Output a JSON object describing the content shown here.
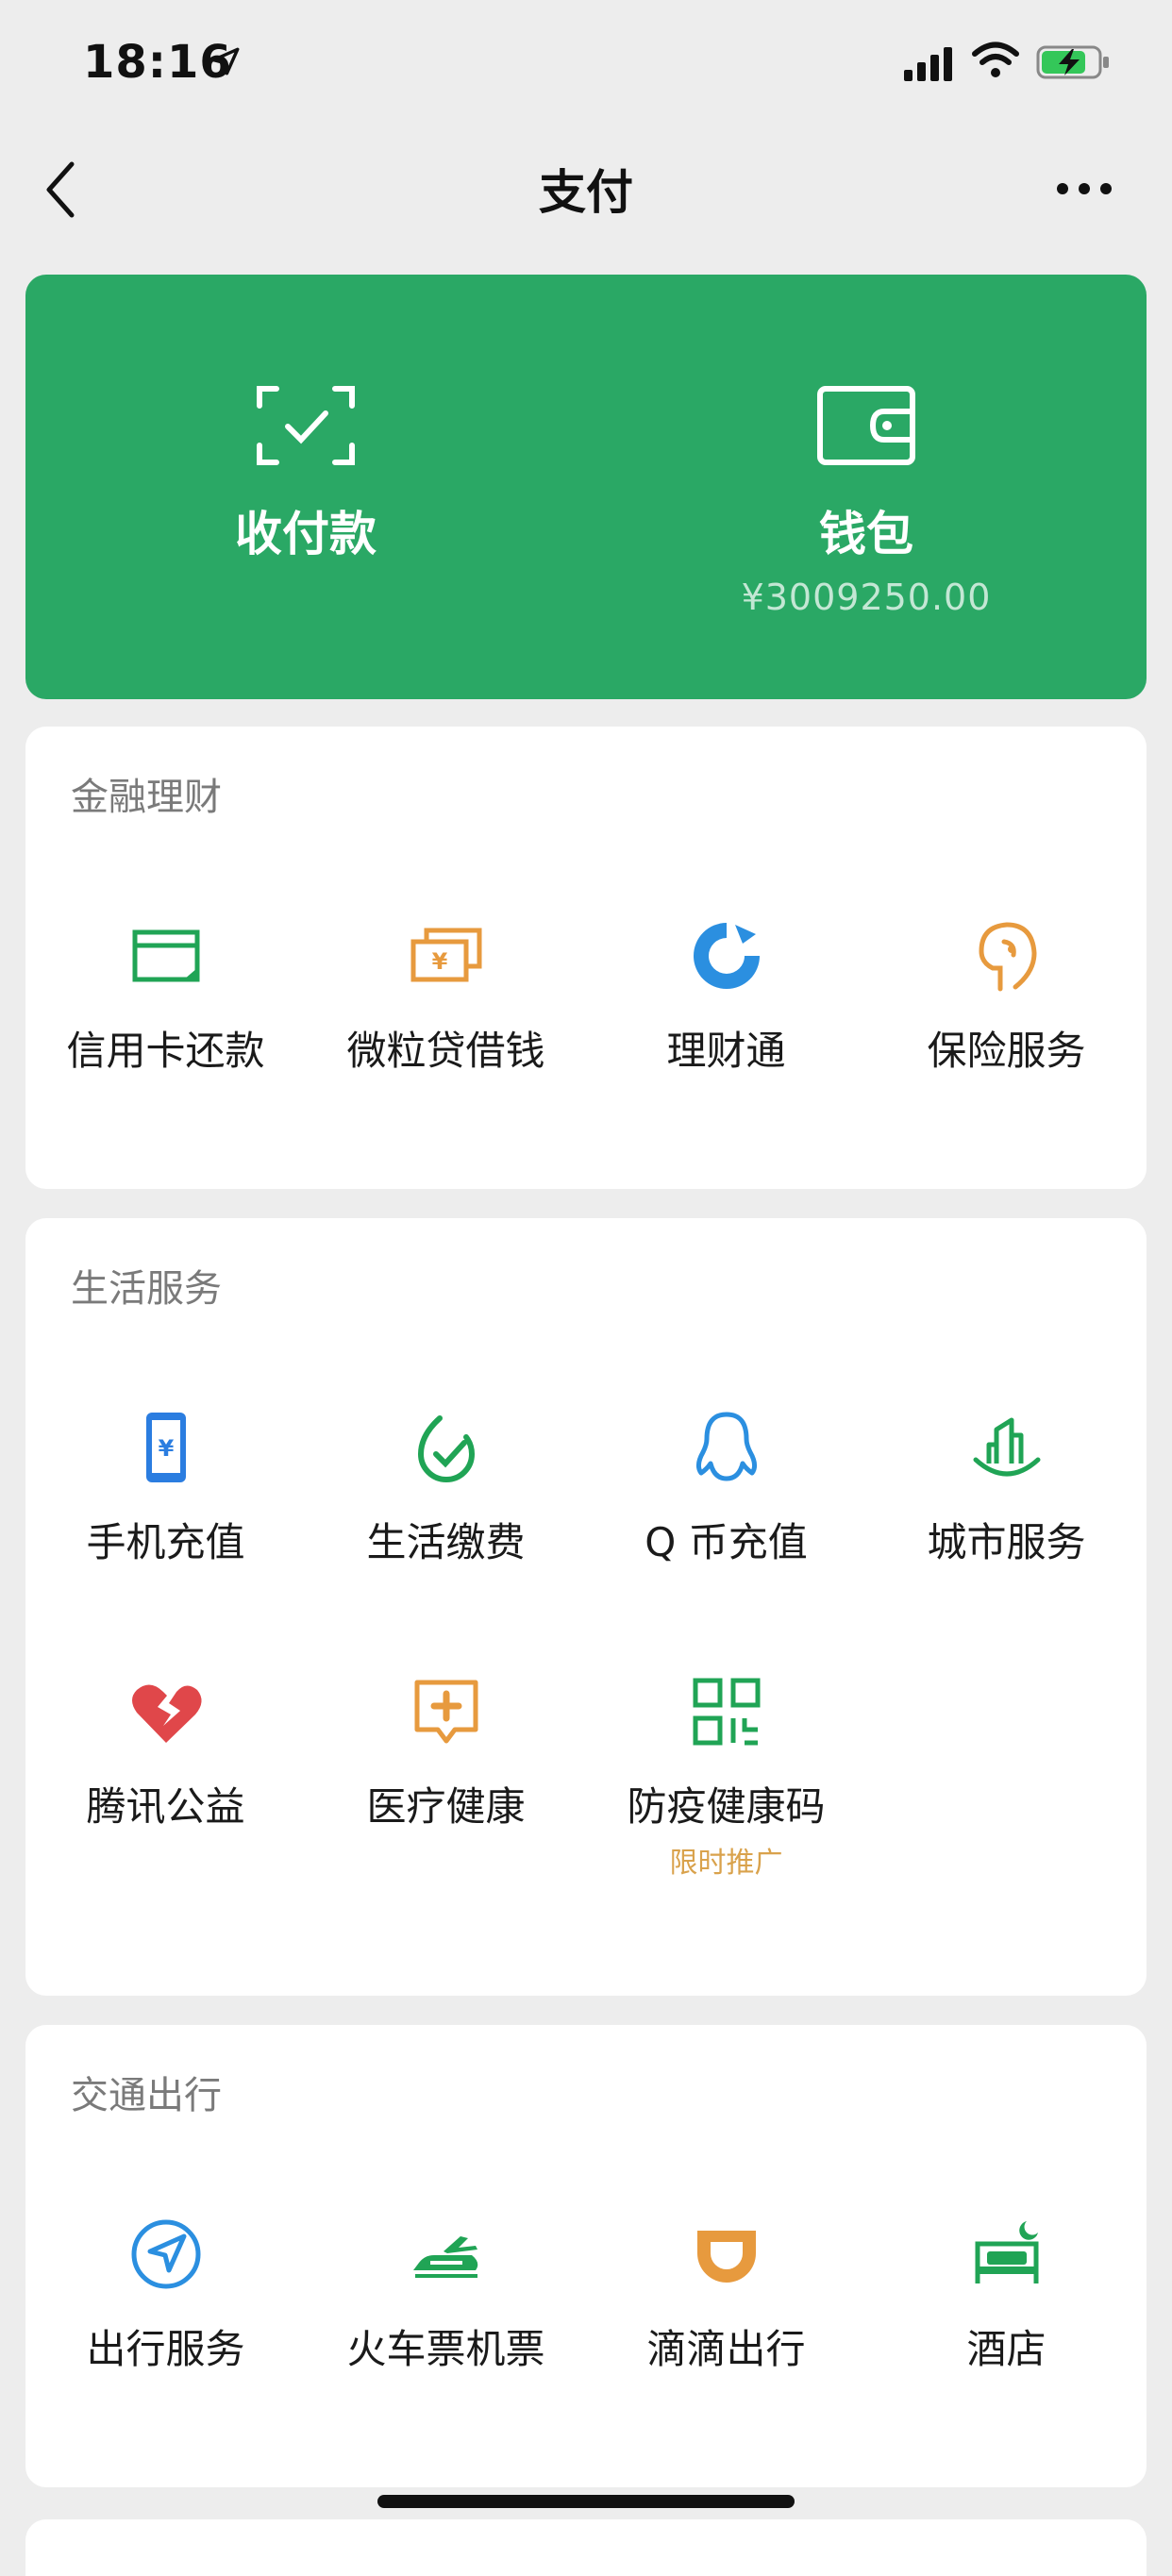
{
  "status_bar": {
    "time": "18:16",
    "icons": [
      "location-arrow-icon",
      "cellular-signal-icon",
      "wifi-icon",
      "battery-charging-icon"
    ]
  },
  "nav": {
    "title": "支付",
    "back_icon": "chevron-left-icon",
    "more_icon": "more-dots-icon"
  },
  "hero": {
    "bg_color": "#2aa865",
    "pay": {
      "label": "收付款",
      "icon": "scan-check-icon"
    },
    "wallet": {
      "label": "钱包",
      "balance": "¥3009250.00",
      "icon": "wallet-icon"
    }
  },
  "finance": {
    "title": "金融理财",
    "items": [
      {
        "label": "信用卡还款",
        "icon": "credit-card-icon",
        "color": "#20a455"
      },
      {
        "label": "微粒贷借钱",
        "icon": "yuan-bills-icon",
        "color": "#e79a3e"
      },
      {
        "label": "理财通",
        "icon": "wealth-icon",
        "color": "#2b8fe0"
      },
      {
        "label": "保险服务",
        "icon": "insurance-icon",
        "color": "#e79a3e"
      }
    ]
  },
  "life": {
    "title": "生活服务",
    "items": [
      {
        "label": "手机充值",
        "icon": "phone-topup-icon",
        "color": "#2b7de0"
      },
      {
        "label": "生活缴费",
        "icon": "utility-bill-icon",
        "color": "#20a455"
      },
      {
        "label": "Q 币充值",
        "icon": "qq-penguin-icon",
        "color": "#2b8fe0"
      },
      {
        "label": "城市服务",
        "icon": "city-service-icon",
        "color": "#20a455"
      },
      {
        "label": "腾讯公益",
        "icon": "charity-heart-icon",
        "color": "#e0474a"
      },
      {
        "label": "医疗健康",
        "icon": "medical-icon",
        "color": "#e79a3e"
      },
      {
        "label": "防疫健康码",
        "sub": "限时推广",
        "icon": "qr-code-icon",
        "color": "#20a455"
      }
    ]
  },
  "travel": {
    "title": "交通出行",
    "items": [
      {
        "label": "出行服务",
        "icon": "navigation-icon",
        "color": "#2b8fe0"
      },
      {
        "label": "火车票机票",
        "icon": "train-plane-icon",
        "color": "#20a455"
      },
      {
        "label": "滴滴出行",
        "icon": "didi-icon",
        "color": "#e79a3e"
      },
      {
        "label": "酒店",
        "icon": "hotel-bed-icon",
        "color": "#20a455"
      }
    ]
  }
}
